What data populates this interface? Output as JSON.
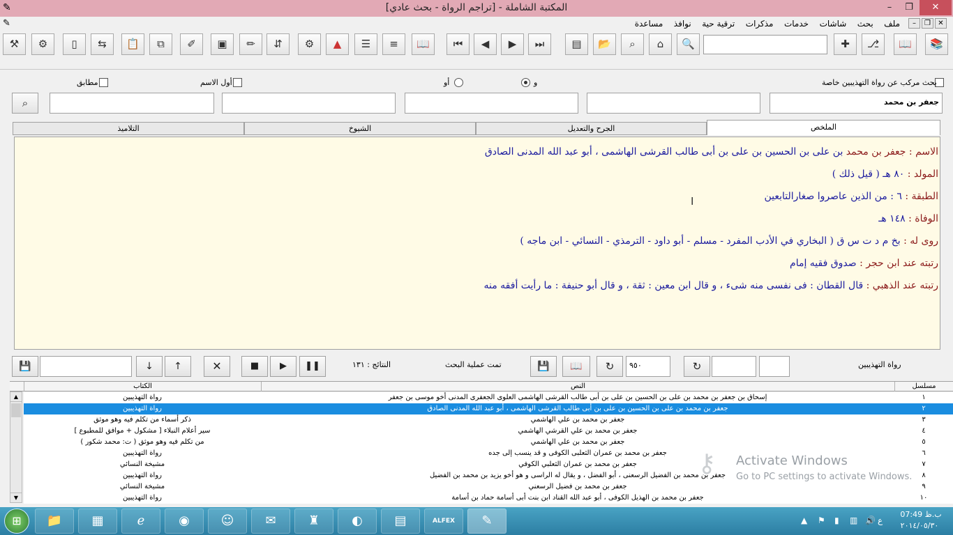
{
  "window": {
    "title": "المكتبة الشاملة - [تراجم الرواة - بحث عادي]",
    "minimize": "–",
    "restore": "❐",
    "close": "✕"
  },
  "menu": [
    "ملف",
    "بحث",
    "شاشات",
    "خدمات",
    "مذكرات",
    "ترقية حية",
    "نوافذ",
    "مساعدة"
  ],
  "search": {
    "compound_label": "بحث مركب عن رواة التهذيبين خاصة",
    "and_label": "و",
    "or_label": "أو",
    "first_name_label": "أول الاسم",
    "exact_label": "مطابق",
    "field1_value": "جعفر بن محمد"
  },
  "tabs": [
    "الملخص",
    "الجرح والتعديل",
    "الشيوخ",
    "التلاميذ"
  ],
  "summary": {
    "name_label": "الاسم :",
    "name_red": "جعفر بن محمد",
    "name_rest": "بن على بن الحسين بن على بن أبى طالب القرشى الهاشمى ، أبو عبد الله المدنى الصادق",
    "birth_label": "المولد :",
    "birth_value": "٨٠ هـ ( قيل ذلك )",
    "tabaqa_label": "الطبقة :",
    "tabaqa_value": "٦ : من الذين عاصروا صغارالتابعين",
    "death_label": "الوفاة :",
    "death_value": "١٤٨ هـ",
    "narrated_label": "روى له :",
    "narrated_value": "بخ م د ت س ق ( البخاري في الأدب المفرد - مسلم - أبو داود - الترمذي - النسائي - ابن ماجه )",
    "rank_hajar_label": "رتبته عند ابن حجر :",
    "rank_hajar_value": "صدوق فقيه إمام",
    "rank_dhahabi_label": "رتبته عند الذهبي :",
    "rank_dhahabi_value": "قال القطان : فى نفسى منه شىء ، و قال ابن معين : ثقة ، و قال أبو حنيفة : ما رأيت أفقه منه"
  },
  "controls": {
    "results": "النتائج : ١٣١",
    "status": "تمت عملية البحث",
    "count_value": "٩٥٠",
    "source_label": "رواة التهذيبين"
  },
  "grid": {
    "headers": {
      "serial": "مسلسل",
      "text": "النص",
      "book": "الكتاب"
    },
    "rows": [
      {
        "serial": "١",
        "text": "إسحاق بن جعفر بن محمد بن على بن الحسين بن على بن أبى طالب القرشى الهاشمى العلوى الجعفرى المدنى أخو موسى بن جعفر",
        "book": "رواة التهذيبين"
      },
      {
        "serial": "٢",
        "text": "جعفر بن محمد بن على بن الحسين بن على بن أبى طالب القرشى الهاشمى ، أبو عبد الله المدنى الصادق",
        "book": "رواة التهذيبين"
      },
      {
        "serial": "٣",
        "text": "جعفر بن محمد بن علي الهاشمي",
        "book": "ذكر أسماء من تكلم فيه وهو موثق"
      },
      {
        "serial": "٤",
        "text": "جعفر بن محمد بن علي القرشي الهاشمي",
        "book": "سير أعلام النبلاء [ مشكول + موافق للمطبوع ]"
      },
      {
        "serial": "٥",
        "text": "جعفر بن محمد بن علي الهاشمي",
        "book": "من تكلم فيه وهو موثق ( ت: محمد شكور )"
      },
      {
        "serial": "٦",
        "text": "جعفر بن محمد بن عمران الثعلبى الكوفى و قد ينسب إلى جده",
        "book": "رواة التهذيبين"
      },
      {
        "serial": "٧",
        "text": "جعفر بن محمد بن عمران الثعلبي الكوفي",
        "book": "مشيخة النسائي"
      },
      {
        "serial": "٨",
        "text": "جعفر بن محمد بن الفضيل الرسعنى ، أبو الفضل ، و يقال له الراسى و هو أخو يزيد بن محمد بن الفضيل",
        "book": "رواة التهذيبين"
      },
      {
        "serial": "٩",
        "text": "جعفر بن محمد بن فضيل الرسعني",
        "book": "مشيخة النسائي"
      },
      {
        "serial": "١٠",
        "text": "جعفر بن محمد بن الهذيل الكوفى ، أبو عبد الله القناد ابن بنت أبى أسامة حماد بن أسامة",
        "book": "رواة التهذيبين"
      }
    ]
  },
  "watermark": {
    "title": "Activate Windows",
    "subtitle": "Go to PC settings to activate Windows."
  },
  "tray": {
    "time": "07:49 ب.ظ",
    "date": "٢٠١٤/٠٥/٣٠",
    "lang": "ع"
  }
}
